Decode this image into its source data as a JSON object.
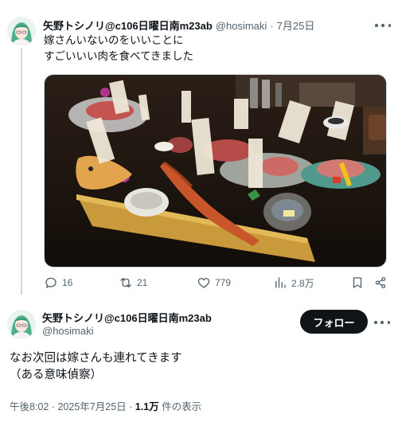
{
  "tweet": {
    "display_name": "矢野トシノリ@c106日曜日南m23ab",
    "handle": "@hosimaki",
    "separator": "·",
    "date": "7月25日",
    "text_line1": "嫁さんいないのをいいことに",
    "text_line2": "すごいいい肉を食べてきました",
    "media_icon": "yakiniku-photo",
    "actions": {
      "reply_count": "16",
      "retweet_count": "21",
      "like_count": "779",
      "view_count": "2.8万"
    }
  },
  "reply": {
    "display_name": "矢野トシノリ@c106日曜日南m23ab",
    "handle": "@hosimaki",
    "follow_label": "フォロー",
    "text_line1": "なお次回は嫁さんも連れてきます",
    "text_line2": "（ある意味偵察）",
    "time": "午後8:02",
    "separator": "·",
    "date": "2025年7月25日",
    "views_count": "1.1万",
    "views_label": "件の表示"
  },
  "colors": {
    "text": "#0f1419",
    "secondary": "#536471",
    "follow_bg": "#0f1419",
    "avatar_hair": "#4fb08c"
  },
  "icons": [
    "more-icon",
    "reply-icon",
    "retweet-icon",
    "like-icon",
    "views-icon",
    "bookmark-icon",
    "share-icon"
  ]
}
